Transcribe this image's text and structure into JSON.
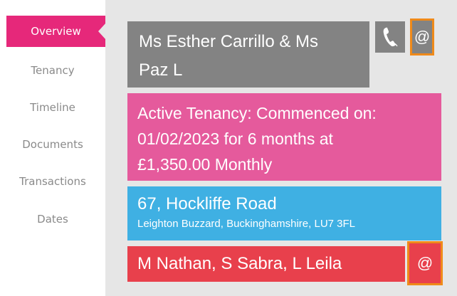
{
  "sidebar": {
    "items": [
      {
        "label": "Overview",
        "active": true
      },
      {
        "label": "Tenancy"
      },
      {
        "label": "Timeline"
      },
      {
        "label": "Documents"
      },
      {
        "label": "Transactions"
      },
      {
        "label": "Dates"
      }
    ]
  },
  "tenant": {
    "name_line1": "Ms Esther Carrillo & Ms",
    "name_line2": "Paz L",
    "phone_icon": "phone-icon",
    "email_symbol": "@"
  },
  "tenancy": {
    "line1": "Active Tenancy: Commenced on:",
    "line2": "01/02/2023 for 6 months at",
    "line3": "£1,350.00 Monthly"
  },
  "address": {
    "line1": "67, Hockliffe Road",
    "line2": "Leighton Buzzard, Buckinghamshire, LU7 3FL"
  },
  "landlord": {
    "names": "M Nathan, S Sabra, L Leila",
    "email_symbol": "@"
  },
  "colors": {
    "accent": "#e6287a",
    "tenant_box": "#838383",
    "tenancy_box": "#e55a9c",
    "address_box": "#3fb0e3",
    "landlord_box": "#e8404c",
    "highlight": "#ef8a1a"
  }
}
